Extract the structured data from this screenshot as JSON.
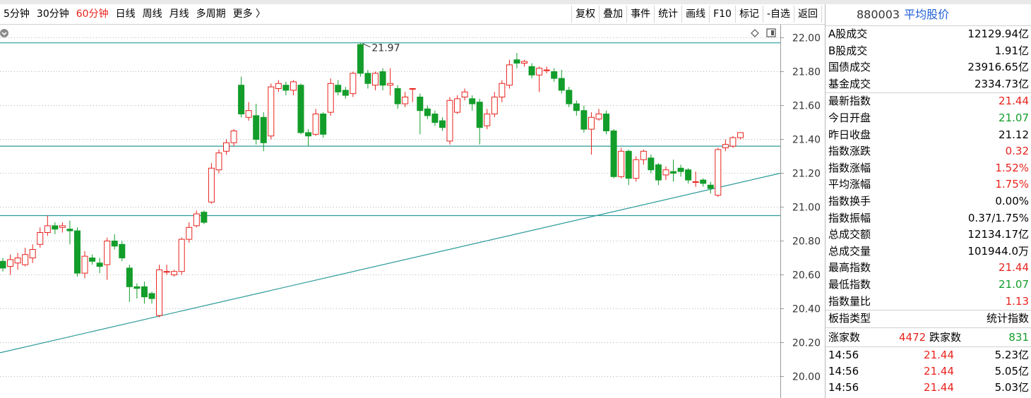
{
  "toolbar": {
    "periods": [
      "5分钟",
      "30分钟",
      "60分钟",
      "日线",
      "周线",
      "月线",
      "多周期",
      "更多 〉"
    ],
    "active_period": "60分钟",
    "tools": [
      "复权",
      "叠加",
      "事件",
      "统计",
      "画线",
      "F10",
      "标记",
      "-自选",
      "返回"
    ]
  },
  "icons": [
    "gear-icon",
    "diamond-icon",
    "toggle-panel-icon"
  ],
  "colors": {
    "up": "#e8231d",
    "down": "#139d2a",
    "trendline": "#2a9a9a",
    "grid": "#b4b4b4"
  },
  "chart_data": {
    "type": "candlestick",
    "y_range": [
      20.0,
      22.0
    ],
    "y_ticks": [
      "22.00",
      "21.80",
      "21.60",
      "21.40",
      "21.20",
      "21.00",
      "20.80",
      "20.60",
      "20.40",
      "20.20",
      "20.00"
    ],
    "grid": true,
    "horizontal_lines": [
      21.97,
      21.36,
      20.95
    ],
    "trendline": {
      "start": 20.14,
      "end": 21.2
    },
    "max_annotation": "21.97",
    "candles": [
      {
        "o": 20.68,
        "c": 20.64,
        "h": 20.7,
        "l": 20.62
      },
      {
        "o": 20.65,
        "c": 20.69,
        "h": 20.72,
        "l": 20.6
      },
      {
        "o": 20.67,
        "c": 20.7,
        "h": 20.73,
        "l": 20.63
      },
      {
        "o": 20.66,
        "c": 20.72,
        "h": 20.76,
        "l": 20.65
      },
      {
        "o": 20.7,
        "c": 20.75,
        "h": 20.78,
        "l": 20.67
      },
      {
        "o": 20.78,
        "c": 20.85,
        "h": 20.88,
        "l": 20.76
      },
      {
        "o": 20.85,
        "c": 20.89,
        "h": 20.95,
        "l": 20.83
      },
      {
        "o": 20.89,
        "c": 20.87,
        "h": 20.91,
        "l": 20.84
      },
      {
        "o": 20.88,
        "c": 20.89,
        "h": 20.91,
        "l": 20.85
      },
      {
        "o": 20.87,
        "c": 20.86,
        "h": 20.92,
        "l": 20.78
      },
      {
        "o": 20.86,
        "c": 20.61,
        "h": 20.88,
        "l": 20.59
      },
      {
        "o": 20.61,
        "c": 20.71,
        "h": 20.74,
        "l": 20.58
      },
      {
        "o": 20.7,
        "c": 20.68,
        "h": 20.72,
        "l": 20.66
      },
      {
        "o": 20.67,
        "c": 20.65,
        "h": 20.7,
        "l": 20.61
      },
      {
        "o": 20.66,
        "c": 20.8,
        "h": 20.82,
        "l": 20.57
      },
      {
        "o": 20.8,
        "c": 20.77,
        "h": 20.84,
        "l": 20.75
      },
      {
        "o": 20.78,
        "c": 20.7,
        "h": 20.8,
        "l": 20.68
      },
      {
        "o": 20.64,
        "c": 20.53,
        "h": 20.66,
        "l": 20.44
      },
      {
        "o": 20.53,
        "c": 20.52,
        "h": 20.55,
        "l": 20.46
      },
      {
        "o": 20.53,
        "c": 20.47,
        "h": 20.56,
        "l": 20.43
      },
      {
        "o": 20.49,
        "c": 20.46,
        "h": 20.5,
        "l": 20.43
      },
      {
        "o": 20.36,
        "c": 20.63,
        "h": 20.66,
        "l": 20.35
      },
      {
        "o": 20.62,
        "c": 20.62,
        "h": 20.66,
        "l": 20.6
      },
      {
        "o": 20.6,
        "c": 20.62,
        "h": 20.63,
        "l": 20.59
      },
      {
        "o": 20.62,
        "c": 20.81,
        "h": 20.82,
        "l": 20.6
      },
      {
        "o": 20.81,
        "c": 20.88,
        "h": 20.91,
        "l": 20.79
      },
      {
        "o": 20.89,
        "c": 20.96,
        "h": 20.98,
        "l": 20.88
      },
      {
        "o": 20.97,
        "c": 20.91,
        "h": 20.98,
        "l": 20.9
      },
      {
        "o": 21.03,
        "c": 21.23,
        "h": 21.26,
        "l": 21.02
      },
      {
        "o": 21.22,
        "c": 21.32,
        "h": 21.34,
        "l": 21.2
      },
      {
        "o": 21.33,
        "c": 21.38,
        "h": 21.4,
        "l": 21.31
      },
      {
        "o": 21.38,
        "c": 21.45,
        "h": 21.46,
        "l": 21.36
      },
      {
        "o": 21.72,
        "c": 21.55,
        "h": 21.77,
        "l": 21.53
      },
      {
        "o": 21.53,
        "c": 21.57,
        "h": 21.62,
        "l": 21.51
      },
      {
        "o": 21.54,
        "c": 21.4,
        "h": 21.61,
        "l": 21.37
      },
      {
        "o": 21.53,
        "c": 21.38,
        "h": 21.56,
        "l": 21.33
      },
      {
        "o": 21.42,
        "c": 21.71,
        "h": 21.73,
        "l": 21.4
      },
      {
        "o": 21.7,
        "c": 21.73,
        "h": 21.75,
        "l": 21.68
      },
      {
        "o": 21.72,
        "c": 21.69,
        "h": 21.74,
        "l": 21.66
      },
      {
        "o": 21.69,
        "c": 21.74,
        "h": 21.75,
        "l": 21.66
      },
      {
        "o": 21.72,
        "c": 21.44,
        "h": 21.73,
        "l": 21.43
      },
      {
        "o": 21.44,
        "c": 21.42,
        "h": 21.46,
        "l": 21.36
      },
      {
        "o": 21.43,
        "c": 21.55,
        "h": 21.58,
        "l": 21.42
      },
      {
        "o": 21.55,
        "c": 21.43,
        "h": 21.56,
        "l": 21.41
      },
      {
        "o": 21.56,
        "c": 21.73,
        "h": 21.76,
        "l": 21.54
      },
      {
        "o": 21.72,
        "c": 21.68,
        "h": 21.75,
        "l": 21.66
      },
      {
        "o": 21.69,
        "c": 21.66,
        "h": 21.71,
        "l": 21.64
      },
      {
        "o": 21.67,
        "c": 21.79,
        "h": 21.8,
        "l": 21.65
      },
      {
        "o": 21.96,
        "c": 21.79,
        "h": 21.97,
        "l": 21.77
      },
      {
        "o": 21.79,
        "c": 21.73,
        "h": 21.81,
        "l": 21.7
      },
      {
        "o": 21.72,
        "c": 21.79,
        "h": 21.8,
        "l": 21.69
      },
      {
        "o": 21.8,
        "c": 21.72,
        "h": 21.82,
        "l": 21.69
      },
      {
        "o": 21.72,
        "c": 21.73,
        "h": 21.82,
        "l": 21.66
      },
      {
        "o": 21.7,
        "c": 21.61,
        "h": 21.72,
        "l": 21.58
      },
      {
        "o": 21.61,
        "c": 21.65,
        "h": 21.68,
        "l": 21.59
      },
      {
        "o": 21.7,
        "c": 21.7,
        "h": 21.7,
        "l": 21.62
      },
      {
        "o": 21.65,
        "c": 21.57,
        "h": 21.67,
        "l": 21.43
      },
      {
        "o": 21.58,
        "c": 21.54,
        "h": 21.6,
        "l": 21.52
      },
      {
        "o": 21.55,
        "c": 21.5,
        "h": 21.57,
        "l": 21.48
      },
      {
        "o": 21.51,
        "c": 21.47,
        "h": 21.53,
        "l": 21.45
      },
      {
        "o": 21.39,
        "c": 21.63,
        "h": 21.65,
        "l": 21.37
      },
      {
        "o": 21.56,
        "c": 21.64,
        "h": 21.66,
        "l": 21.55
      },
      {
        "o": 21.65,
        "c": 21.68,
        "h": 21.7,
        "l": 21.63
      },
      {
        "o": 21.64,
        "c": 21.61,
        "h": 21.66,
        "l": 21.57
      },
      {
        "o": 21.62,
        "c": 21.47,
        "h": 21.64,
        "l": 21.37
      },
      {
        "o": 21.48,
        "c": 21.55,
        "h": 21.58,
        "l": 21.46
      },
      {
        "o": 21.55,
        "c": 21.65,
        "h": 21.68,
        "l": 21.53
      },
      {
        "o": 21.65,
        "c": 21.73,
        "h": 21.75,
        "l": 21.62
      },
      {
        "o": 21.72,
        "c": 21.84,
        "h": 21.87,
        "l": 21.7
      },
      {
        "o": 21.87,
        "c": 21.85,
        "h": 21.91,
        "l": 21.82
      },
      {
        "o": 21.85,
        "c": 21.86,
        "h": 21.87,
        "l": 21.83
      },
      {
        "o": 21.83,
        "c": 21.78,
        "h": 21.85,
        "l": 21.76
      },
      {
        "o": 21.78,
        "c": 21.82,
        "h": 21.83,
        "l": 21.68
      },
      {
        "o": 21.81,
        "c": 21.81,
        "h": 21.83,
        "l": 21.79
      },
      {
        "o": 21.8,
        "c": 21.76,
        "h": 21.82,
        "l": 21.74
      },
      {
        "o": 21.76,
        "c": 21.69,
        "h": 21.81,
        "l": 21.67
      },
      {
        "o": 21.69,
        "c": 21.61,
        "h": 21.71,
        "l": 21.59
      },
      {
        "o": 21.61,
        "c": 21.57,
        "h": 21.63,
        "l": 21.54
      },
      {
        "o": 21.57,
        "c": 21.46,
        "h": 21.6,
        "l": 21.44
      },
      {
        "o": 21.46,
        "c": 21.53,
        "h": 21.56,
        "l": 21.31
      },
      {
        "o": 21.52,
        "c": 21.55,
        "h": 21.58,
        "l": 21.51
      },
      {
        "o": 21.55,
        "c": 21.45,
        "h": 21.57,
        "l": 21.43
      },
      {
        "o": 21.45,
        "c": 21.18,
        "h": 21.46,
        "l": 21.17
      },
      {
        "o": 21.18,
        "c": 21.33,
        "h": 21.35,
        "l": 21.17
      },
      {
        "o": 21.33,
        "c": 21.17,
        "h": 21.34,
        "l": 21.13
      },
      {
        "o": 21.17,
        "c": 21.28,
        "h": 21.3,
        "l": 21.15
      },
      {
        "o": 21.28,
        "c": 21.33,
        "h": 21.34,
        "l": 21.25
      },
      {
        "o": 21.29,
        "c": 21.22,
        "h": 21.31,
        "l": 21.2
      },
      {
        "o": 21.25,
        "c": 21.16,
        "h": 21.26,
        "l": 21.13
      },
      {
        "o": 21.19,
        "c": 21.22,
        "h": 21.24,
        "l": 21.16
      },
      {
        "o": 21.21,
        "c": 21.2,
        "h": 21.28,
        "l": 21.15
      },
      {
        "o": 21.23,
        "c": 21.21,
        "h": 21.25,
        "l": 21.18
      },
      {
        "o": 21.22,
        "c": 21.16,
        "h": 21.23,
        "l": 21.14
      },
      {
        "o": 21.15,
        "c": 21.15,
        "h": 21.21,
        "l": 21.12
      },
      {
        "o": 21.16,
        "c": 21.14,
        "h": 21.17,
        "l": 21.12
      },
      {
        "o": 21.13,
        "c": 21.11,
        "h": 21.15,
        "l": 21.08
      },
      {
        "o": 21.07,
        "c": 21.34,
        "h": 21.35,
        "l": 21.06
      },
      {
        "o": 21.35,
        "c": 21.37,
        "h": 21.4,
        "l": 21.33
      },
      {
        "o": 21.36,
        "c": 21.41,
        "h": 21.42,
        "l": 21.35
      },
      {
        "o": 21.41,
        "c": 21.44,
        "h": 21.44,
        "l": 21.4
      }
    ]
  },
  "panel": {
    "code": "880003",
    "name": "平均股价",
    "rows": [
      {
        "label": "A股成交",
        "value": "12129.94亿",
        "color": "default",
        "sep": false
      },
      {
        "label": "B股成交",
        "value": "1.91亿",
        "color": "default",
        "sep": false
      },
      {
        "label": "国债成交",
        "value": "23916.65亿",
        "color": "default",
        "sep": false
      },
      {
        "label": "基金成交",
        "value": "2334.73亿",
        "color": "default",
        "sep": false
      },
      {
        "label": "最新指数",
        "value": "21.44",
        "color": "red",
        "sep": true
      },
      {
        "label": "今日开盘",
        "value": "21.07",
        "color": "green",
        "sep": false
      },
      {
        "label": "昨日收盘",
        "value": "21.12",
        "color": "default",
        "sep": false
      },
      {
        "label": "指数涨跌",
        "value": "0.32",
        "color": "red",
        "sep": false
      },
      {
        "label": "指数涨幅",
        "value": "1.52%",
        "color": "red",
        "sep": false
      },
      {
        "label": "平均涨幅",
        "value": "1.75%",
        "color": "red",
        "sep": false
      },
      {
        "label": "指数换手",
        "value": "0.00%",
        "color": "default",
        "sep": false
      },
      {
        "label": "指数振幅",
        "value": "0.37/1.75%",
        "color": "default",
        "sep": false
      },
      {
        "label": "总成交额",
        "value": "12134.17亿",
        "color": "default",
        "sep": false
      },
      {
        "label": "总成交量",
        "value": "101944.0万",
        "color": "default",
        "sep": false
      },
      {
        "label": "最高指数",
        "value": "21.44",
        "color": "red",
        "sep": false
      },
      {
        "label": "最低指数",
        "value": "21.07",
        "color": "green",
        "sep": false
      },
      {
        "label": "指数量比",
        "value": "1.13",
        "color": "red",
        "sep": false
      },
      {
        "label": "板指类型",
        "value": "统计指数",
        "color": "default",
        "sep": true
      }
    ],
    "advance": {
      "up_label": "涨家数",
      "up_value": "4472",
      "down_label": "跌家数",
      "down_value": "831"
    },
    "ticks": [
      {
        "time": "14:56",
        "price": "21.44",
        "amount": "5.23亿"
      },
      {
        "time": "14:56",
        "price": "21.44",
        "amount": "5.05亿"
      },
      {
        "time": "14:56",
        "price": "21.44",
        "amount": "5.03亿"
      }
    ]
  }
}
